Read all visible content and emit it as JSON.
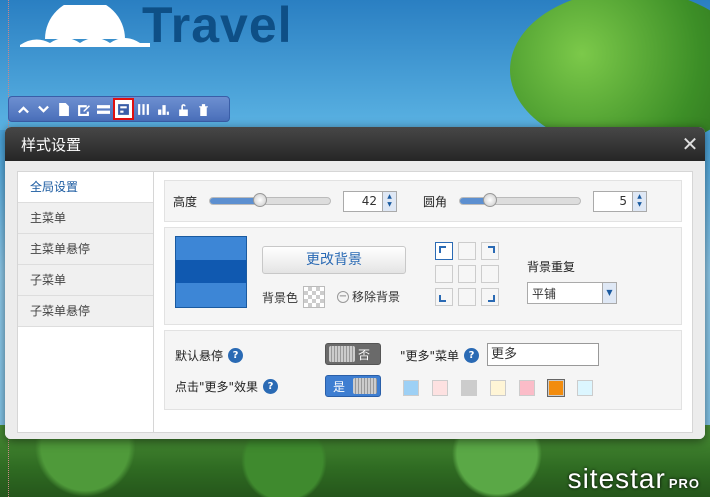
{
  "site": {
    "logo_text": "Travel",
    "watermark_brand": "sitestar",
    "watermark_suffix": "PRO"
  },
  "toolbar": {
    "icons": [
      "arrow-up-icon",
      "arrow-down-icon",
      "page-settings-icon",
      "edit-icon",
      "layout-icon",
      "style-settings-icon",
      "columns-icon",
      "chart-icon",
      "unlock-icon",
      "delete-icon"
    ],
    "active_index": 5
  },
  "dialog": {
    "title": "样式设置",
    "close_label": "✕"
  },
  "sidebar": {
    "items": [
      {
        "label": "全局设置"
      },
      {
        "label": "主菜单"
      },
      {
        "label": "主菜单悬停"
      },
      {
        "label": "子菜单"
      },
      {
        "label": "子菜单悬停"
      }
    ],
    "active_index": 0
  },
  "size": {
    "height_label": "高度",
    "height_value": "42",
    "height_level": 0.42,
    "radius_label": "圆角",
    "radius_value": "5",
    "radius_level": 0.25
  },
  "background": {
    "change_button": "更改背景",
    "color_label": "背景色",
    "remove_label": "移除背景",
    "repeat_label": "背景重复",
    "repeat_value": "平铺",
    "position_selected": 0
  },
  "options": {
    "hover_label": "默认悬停",
    "hover_toggle": "否",
    "more_menu_label": "\"更多\"菜单",
    "more_menu_value": "更多",
    "effect_label": "点击\"更多\"效果",
    "effect_toggle": "是",
    "help_glyph": "?"
  },
  "colors": {
    "swatches": [
      "#9dd0f5",
      "#fde1e1",
      "#cccccc",
      "#fff5d6",
      "#fbbcc8",
      "#f28c0e",
      "#dcf6ff"
    ],
    "selected_index": 5,
    "accent": "#2a6ab4"
  }
}
